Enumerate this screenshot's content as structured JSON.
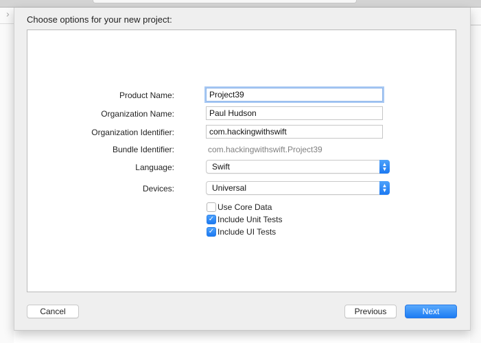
{
  "background": {
    "sidebar_chevron_icon": "chevron-right-icon"
  },
  "sheet": {
    "title": "Choose options for your new project:",
    "form": {
      "product_name": {
        "label": "Product Name:",
        "value": "Project39"
      },
      "organization_name": {
        "label": "Organization Name:",
        "value": "Paul Hudson"
      },
      "organization_identifier": {
        "label": "Organization Identifier:",
        "value": "com.hackingwithswift"
      },
      "bundle_identifier": {
        "label": "Bundle Identifier:",
        "value": "com.hackingwithswift.Project39"
      },
      "language": {
        "label": "Language:",
        "selected": "Swift"
      },
      "devices": {
        "label": "Devices:",
        "selected": "Universal"
      },
      "checkboxes": [
        {
          "label": "Use Core Data",
          "checked": false
        },
        {
          "label": "Include Unit Tests",
          "checked": true
        },
        {
          "label": "Include UI Tests",
          "checked": true
        }
      ]
    },
    "buttons": {
      "cancel": "Cancel",
      "previous": "Previous",
      "next": "Next"
    }
  },
  "colors": {
    "accent": "#1b79f2",
    "focus_ring": "#a7c8f3",
    "sheet_bg": "#efefef"
  }
}
